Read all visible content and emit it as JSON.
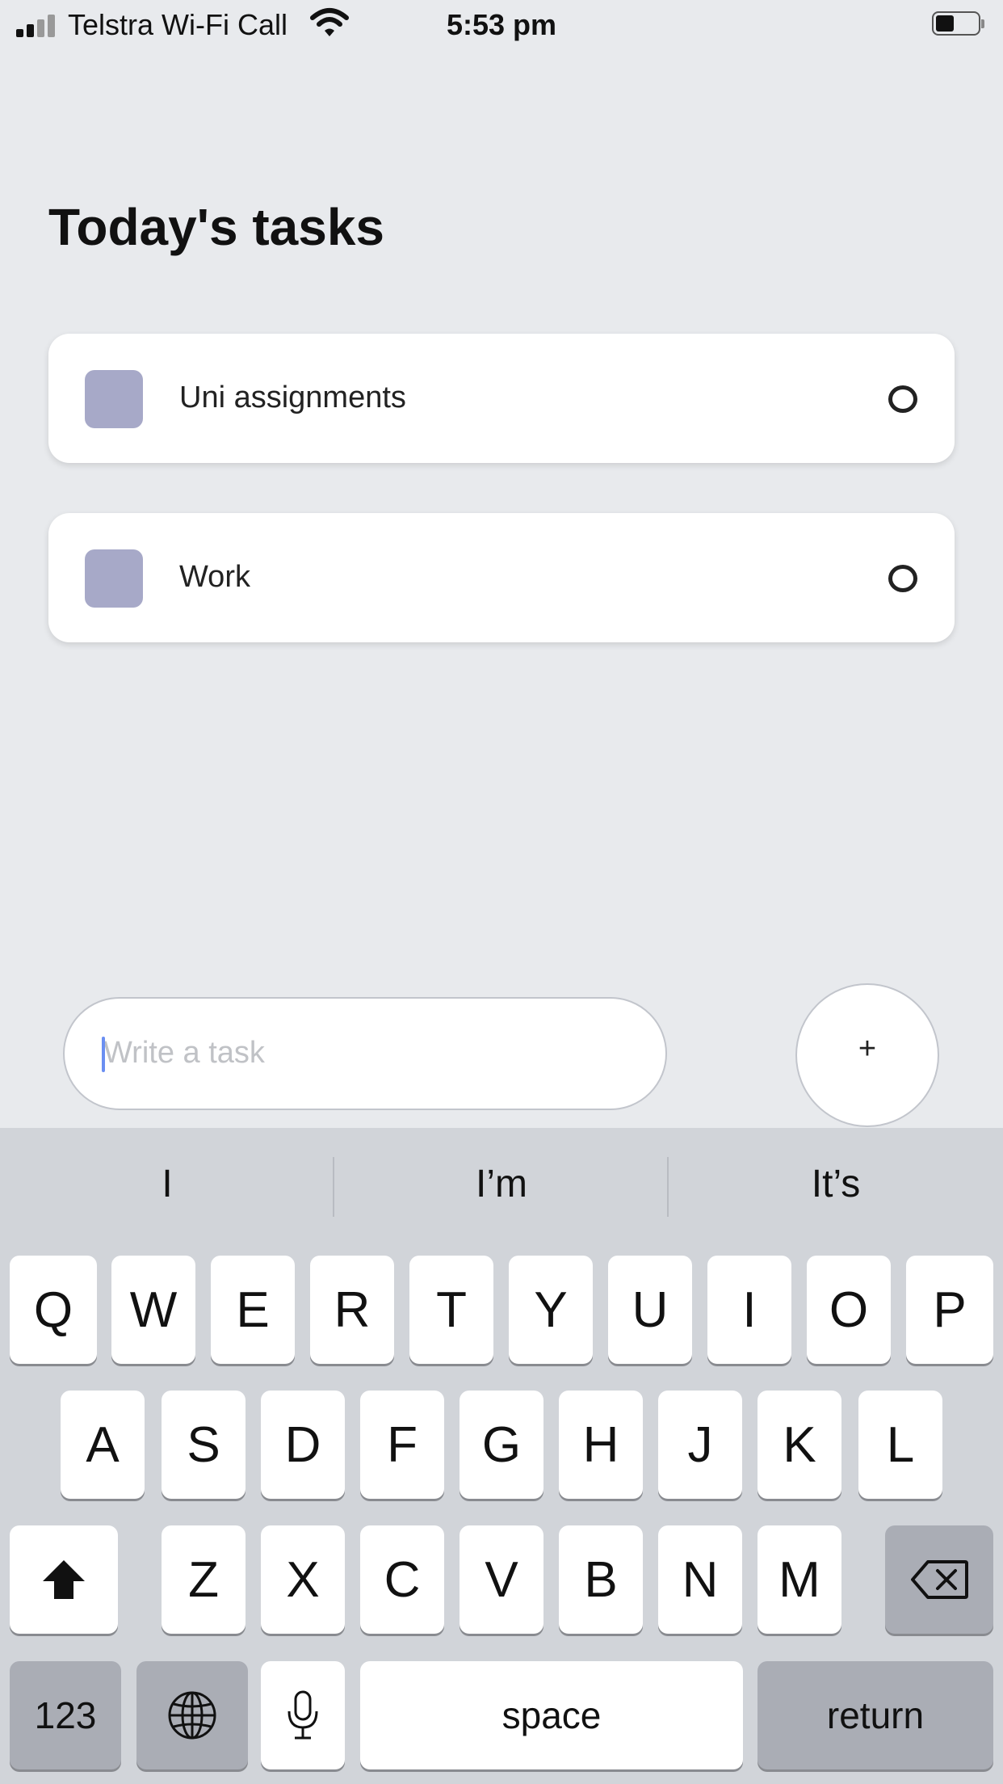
{
  "status_bar": {
    "carrier": "Telstra Wi-Fi Call",
    "time": "5:53 pm",
    "icons": [
      "signal-icon",
      "wifi-icon",
      "battery-icon"
    ]
  },
  "page": {
    "title": "Today's tasks"
  },
  "tasks": [
    {
      "label": "Uni assignments"
    },
    {
      "label": "Work"
    }
  ],
  "composer": {
    "placeholder": "Write a task",
    "add_label": "+"
  },
  "keyboard": {
    "suggestions": [
      "I",
      "I’m",
      "It’s"
    ],
    "row1": [
      "Q",
      "W",
      "E",
      "R",
      "T",
      "Y",
      "U",
      "I",
      "O",
      "P"
    ],
    "row2": [
      "A",
      "S",
      "D",
      "F",
      "G",
      "H",
      "J",
      "K",
      "L"
    ],
    "row3": [
      "Z",
      "X",
      "C",
      "V",
      "B",
      "N",
      "M"
    ],
    "numbers_label": "123",
    "space_label": "space",
    "return_label": "return",
    "icons": [
      "shift-icon",
      "backspace-icon",
      "globe-icon",
      "microphone-icon"
    ]
  },
  "colors": {
    "background": "#e8eaed",
    "task_square": "#a7a9c8",
    "keyboard_bg": "#d1d4d9",
    "caret": "#6b8ff2"
  }
}
